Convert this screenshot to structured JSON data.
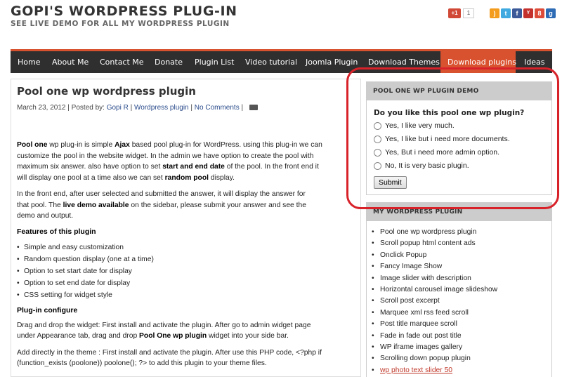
{
  "site": {
    "title": "GOPI'S WORDPRESS PLUG-IN",
    "tagline": "SEE LIVE DEMO FOR ALL MY WORDPRESS PLUGIN",
    "gplus_label": "+1",
    "gplus_count": "1"
  },
  "social_icons": [
    {
      "name": "rss-icon",
      "color": "#f39c1d",
      "glyph": ")"
    },
    {
      "name": "twitter-icon",
      "color": "#3fa9e0",
      "glyph": "t"
    },
    {
      "name": "facebook-icon",
      "color": "#3b5998",
      "glyph": "f"
    },
    {
      "name": "youtube-icon",
      "color": "#c4302b",
      "glyph": "Y"
    },
    {
      "name": "google-icon",
      "color": "#dd4b39",
      "glyph": "8"
    },
    {
      "name": "gplus-icon",
      "color": "#2d6bb5",
      "glyph": "g"
    }
  ],
  "nav": [
    "Home",
    "About Me",
    "Contact Me",
    "Donate",
    "Plugin List",
    "Video tutorial",
    "Joomla Plugin",
    "Download Themes",
    "Download plugins",
    "Ideas"
  ],
  "nav_active": "Download plugins",
  "colors": {
    "accent": "#d95230",
    "nav_bg": "#2f2f2f",
    "ring": "#d8222a",
    "link": "#c0392b"
  },
  "post": {
    "title": "Pool one wp wordpress plugin",
    "date": "March 23, 2012",
    "posted_by_label": "Posted by:",
    "author": "Gopi R",
    "category": "Wordpress plugin",
    "comments": "No Comments",
    "p1": [
      {
        "b": "Pool one"
      },
      {
        "t": " wp plug-in is simple "
      },
      {
        "b": "Ajax"
      },
      {
        "t": " based pool plug-in for WordPress. using this plug-in we can"
      }
    ],
    "p1_line2": "customize the pool in the website widget. In the admin we have option to create the pool with",
    "p1_line3_a": "maximum six answer. also have option to set ",
    "p1_line3_b": "start and end date",
    "p1_line3_c": " of the pool. In the front end it",
    "p1_line4_a": "will display one pool at a time also we can set ",
    "p1_line4_b": "random pool",
    "p1_line4_c": " display.",
    "p2_line1": "In the front end, after user selected and submitted the answer, it will display the answer for",
    "p2_line2_a": "that pool. The ",
    "p2_line2_b": "live demo available",
    "p2_line2_c": " on the sidebar, please submit your answer and see the",
    "p2_line3": "demo and output.",
    "features_heading": "Features of this plugin",
    "features": [
      "Simple and easy customization",
      "Random question display (one at a time)",
      "Option to set start date for display",
      "Option to set end date for display",
      "CSS setting for widget style"
    ],
    "configure_heading": "Plug-in configure",
    "p3_line1": "Drag and drop the widget: First install and activate the plugin. After go to admin  widget page",
    "p3_line2_a": "under Appearance tab, drag and drop ",
    "p3_line2_b": "Pool One wp plugin",
    "p3_line2_c": " widget into your side bar.",
    "p4_line1": "Add directly in the theme : First install and activate the plugin. After use this PHP code, <?php if",
    "p4_line2": "(function_exists (poolone)) poolone(); ?> to add this plugin to your theme files."
  },
  "poll": {
    "heading": "POOL ONE WP PLUGIN DEMO",
    "question": "Do you like this pool one wp plugin?",
    "options": [
      "Yes, I like very much.",
      "Yes, I like but i need more documents.",
      "Yes, But i need more admin option.",
      "No, It is very basic plugin."
    ],
    "submit": "Submit"
  },
  "plugins_box": {
    "heading": "MY WORDPRESS PLUGIN",
    "items": [
      "Pool one wp wordpress plugin",
      "Scroll popup html content ads",
      "Onclick Popup",
      "Fancy Image Show",
      "Image slider with description",
      "Horizontal carousel image slideshow",
      "Scroll post excerpt",
      "Marquee xml rss feed scroll",
      "Post title marquee scroll",
      "Fade in fade out post title",
      "WP iframe images gallery",
      "Scrolling down popup plugin",
      "wp photo text slider 50"
    ]
  }
}
